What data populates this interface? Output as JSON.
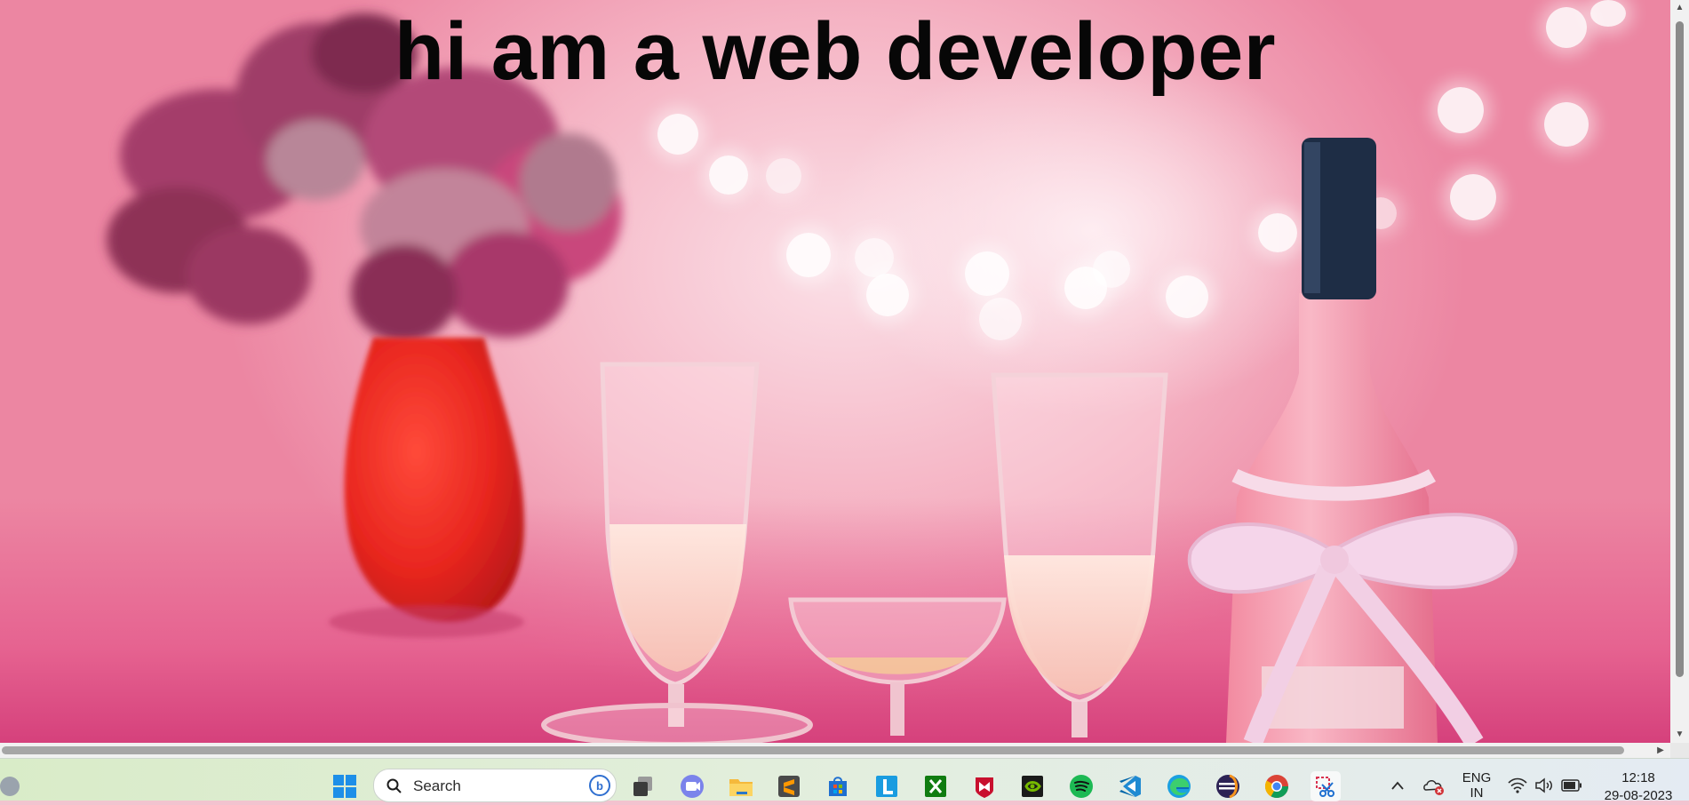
{
  "page": {
    "headline": "hi am a web developer"
  },
  "taskbar": {
    "search_label": "Search",
    "apps": [
      {
        "name": "windows-start-icon"
      },
      {
        "name": "task-view-icon"
      },
      {
        "name": "teams-chat-icon"
      },
      {
        "name": "file-explorer-icon"
      },
      {
        "name": "sublime-text-icon"
      },
      {
        "name": "microsoft-store-icon"
      },
      {
        "name": "l-app-icon"
      },
      {
        "name": "xbox-icon"
      },
      {
        "name": "mcafee-icon"
      },
      {
        "name": "nvidia-icon"
      },
      {
        "name": "spotify-icon"
      },
      {
        "name": "vscode-icon"
      },
      {
        "name": "edge-icon"
      },
      {
        "name": "eclipse-icon"
      },
      {
        "name": "chrome-icon"
      },
      {
        "name": "snipping-tool-icon"
      }
    ],
    "tray": {
      "language_line1": "ENG",
      "language_line2": "IN",
      "time": "12:18",
      "date": "29-08-2023"
    }
  },
  "colors": {
    "headline": "#070707",
    "accent_blue": "#0078d4"
  }
}
